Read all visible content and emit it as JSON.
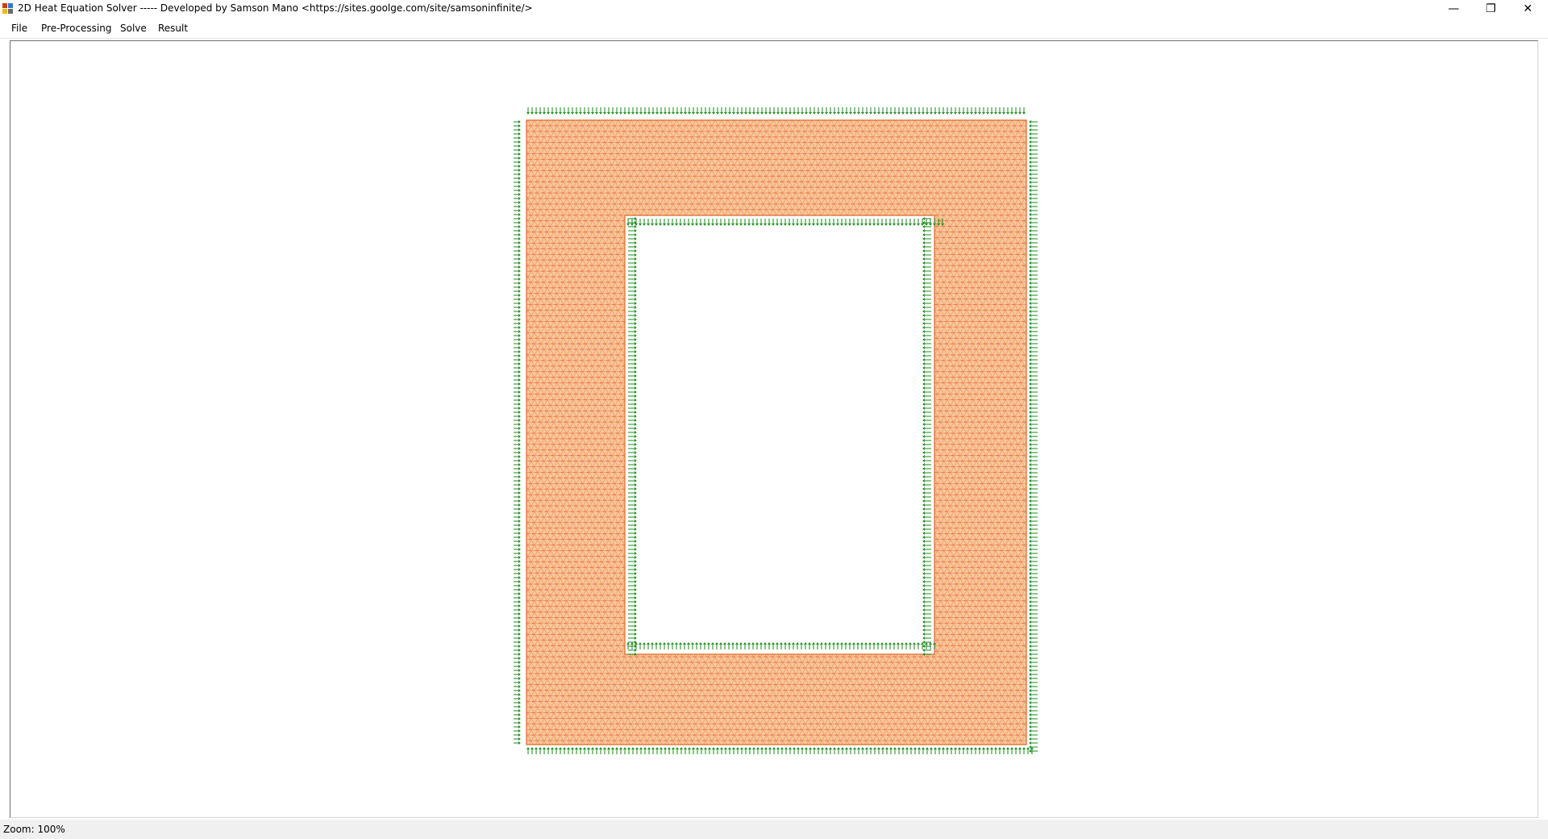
{
  "window": {
    "title": "2D Heat Equation Solver ----- Developed by Samson Mano <https://sites.goolge.com/site/samsoninfinite/>",
    "minimize_glyph": "—",
    "maximize_glyph": "❐",
    "close_glyph": "✕"
  },
  "menu": {
    "items": [
      "File",
      "Pre-Processing",
      "Solve",
      "Result"
    ]
  },
  "status": {
    "zoom": "Zoom: 100%"
  },
  "colors": {
    "mesh_fill": "#f9c69a",
    "mesh_edge": "#e06a2a",
    "node": "#d42020",
    "boundary_arrow": "#1a8a1a"
  },
  "icons": {
    "app": "app-icon",
    "minimize": "minimize-icon",
    "maximize": "restore-icon",
    "close": "close-icon"
  }
}
